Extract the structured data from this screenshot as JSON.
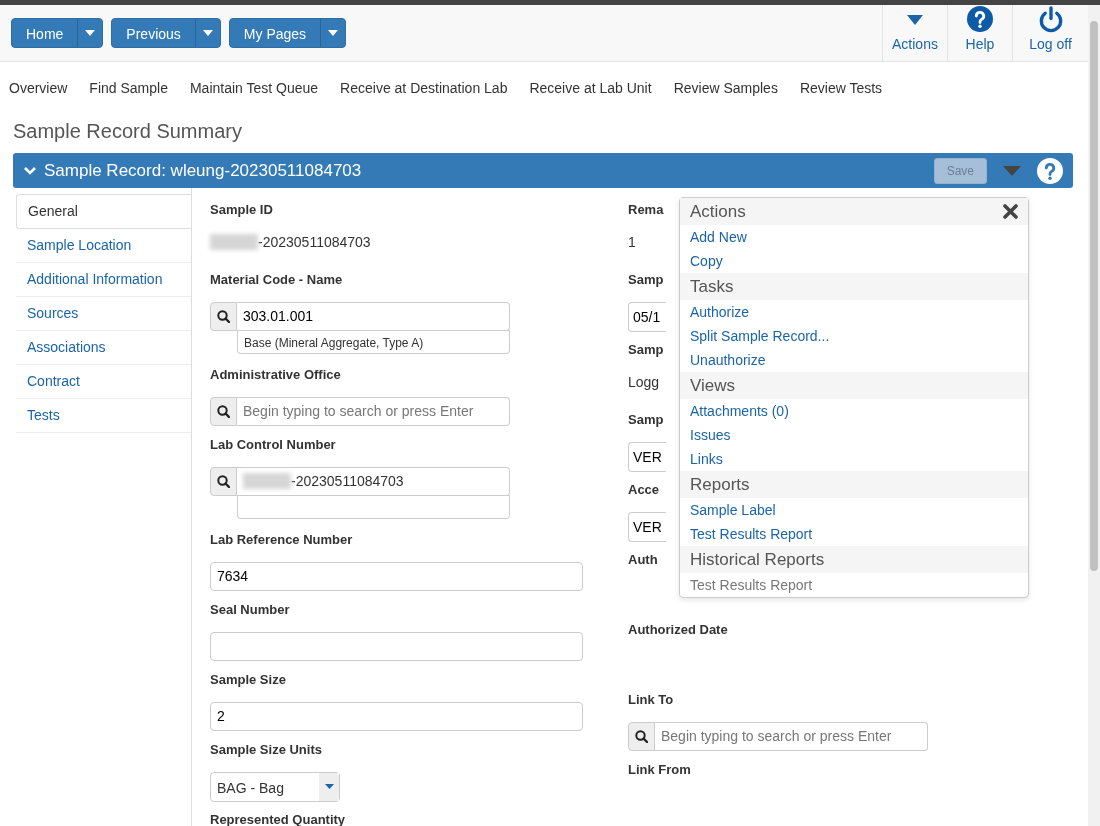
{
  "toolbar": {
    "menu_buttons": [
      {
        "label": "Home"
      },
      {
        "label": "Previous"
      },
      {
        "label": "My Pages"
      }
    ],
    "actions": [
      {
        "kind": "caret",
        "label": "Actions"
      },
      {
        "kind": "help",
        "label": "Help"
      },
      {
        "kind": "power",
        "label": "Log off"
      }
    ]
  },
  "nav_links": [
    "Overview",
    "Find Sample",
    "Maintain Test Queue",
    "Receive at Destination Lab",
    "Receive at Lab Unit",
    "Review Samples",
    "Review Tests"
  ],
  "page_title": "Sample Record Summary",
  "record_panel": {
    "title": "Sample Record: wleung-20230511084703",
    "expanded": true,
    "save_button": {
      "label": "Save",
      "disabled": true
    }
  },
  "side_tabs": [
    {
      "label": "General",
      "selected": true
    },
    {
      "label": "Sample Location",
      "selected": false
    },
    {
      "label": "Additional Information",
      "selected": false
    },
    {
      "label": "Sources",
      "selected": false
    },
    {
      "label": "Associations",
      "selected": false
    },
    {
      "label": "Contract",
      "selected": false
    },
    {
      "label": "Tests",
      "selected": false
    }
  ],
  "left_fields": [
    {
      "kind": "text",
      "label": "Sample ID",
      "value": "-20230511084703",
      "redacted": true
    },
    {
      "kind": "lookup_detail",
      "label": "Material Code - Name",
      "value": "303.01.001",
      "description": "Base (Mineral Aggregate, Type A)"
    },
    {
      "kind": "lookup",
      "label": "Administrative Office",
      "placeholder": "Begin typing to search or press Enter"
    },
    {
      "kind": "lookup_detail",
      "label": "Lab Control Number",
      "value": "-20230511084703",
      "redacted": true
    },
    {
      "kind": "input",
      "label": "Lab Reference Number",
      "value": "7634"
    },
    {
      "kind": "input",
      "label": "Seal Number"
    },
    {
      "kind": "input",
      "label": "Sample Size",
      "value": "2"
    },
    {
      "kind": "select",
      "label": "Sample Size Units",
      "value": "BAG - Bag"
    },
    {
      "kind": "text",
      "label": "Represented Quantity"
    }
  ],
  "right_fields": [
    {
      "kind": "text",
      "label": "Rema",
      "value": "1"
    },
    {
      "kind": "input",
      "label": "Samp",
      "value": "05/1"
    },
    {
      "kind": "text",
      "label": "Samp",
      "value": "Logg"
    },
    {
      "kind": "input",
      "label": "Samp",
      "value": "VER"
    },
    {
      "kind": "input",
      "label": "Acce",
      "value": "VER"
    },
    {
      "kind": "text",
      "label": "Auth"
    },
    {
      "kind": "text",
      "label": "Authorized Date"
    },
    {
      "kind": "lookup",
      "label": "Link To",
      "placeholder": "Begin typing to search or press Enter"
    },
    {
      "kind": "text",
      "label": "Link From"
    }
  ],
  "actions_menu": {
    "closable": true,
    "sections": [
      {
        "title": "Actions",
        "items": [
          {
            "label": "Add New",
            "disabled": false
          },
          {
            "label": "Copy",
            "disabled": false
          }
        ]
      },
      {
        "title": "Tasks",
        "items": [
          {
            "label": "Authorize",
            "disabled": false
          },
          {
            "label": "Split Sample Record...",
            "disabled": false
          },
          {
            "label": "Unauthorize",
            "disabled": false
          }
        ]
      },
      {
        "title": "Views",
        "items": [
          {
            "label": "Attachments (0)",
            "disabled": false
          },
          {
            "label": "Issues",
            "disabled": false
          },
          {
            "label": "Links",
            "disabled": false
          }
        ]
      },
      {
        "title": "Reports",
        "items": [
          {
            "label": "Sample Label",
            "disabled": false
          },
          {
            "label": "Test Results Report",
            "disabled": false
          }
        ]
      },
      {
        "title": "Historical Reports",
        "items": [
          {
            "label": "Test Results Report",
            "disabled": true
          }
        ]
      }
    ]
  }
}
